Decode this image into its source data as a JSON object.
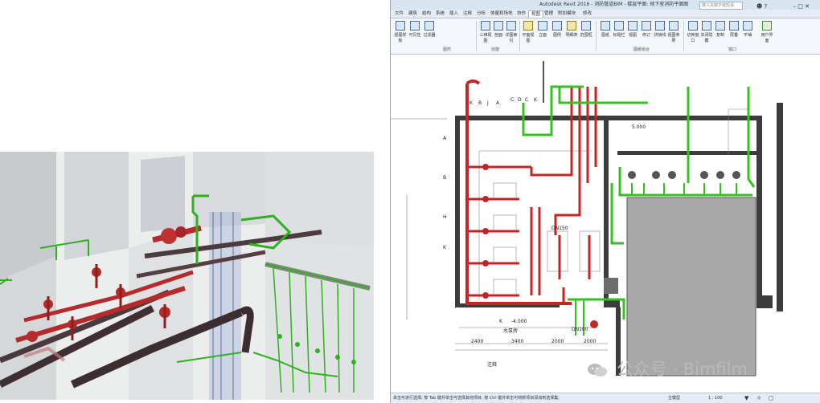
{
  "revit": {
    "title": "Autodesk Revit 2016 -   消防管道BIM - 楼层平面: 地下室消防平面图",
    "search_placeholder": "键入关键字或短语",
    "tabs": [
      "文件",
      "建筑",
      "结构",
      "系统",
      "插入",
      "注释",
      "分析",
      "体量和场地",
      "协作",
      "视图",
      "管理",
      "附加模块",
      "修改"
    ],
    "active_tab_index": 9,
    "panels": [
      {
        "label": "图形",
        "buttons": [
          "视图样板",
          "可见性",
          "过滤器"
        ]
      },
      {
        "label": "创建",
        "buttons": [
          "三维视图",
          "剖面",
          "详图索引",
          "平面视图",
          "立面",
          "图例",
          "明细表",
          "范围框"
        ]
      },
      {
        "label": "图纸组合",
        "buttons": [
          "图纸",
          "标题栏",
          "视图",
          "修订",
          "拼接线",
          "视图参照"
        ]
      },
      {
        "label": "窗口",
        "buttons": [
          "切换窗口",
          "关闭隐藏",
          "复制",
          "层叠",
          "平铺",
          "用户界面"
        ]
      }
    ],
    "plan_labels": {
      "grid_row_1": "A",
      "grid_row_2": "B",
      "grid_row_3": "H",
      "grid_row_4": "K",
      "grid_row_5": "K",
      "top_marks": [
        "K",
        "B",
        "J",
        "A",
        "C",
        "D",
        "C",
        "K"
      ],
      "elev_top": "5.000",
      "elev_bottom": "-4.000",
      "room_name": "水泵房",
      "dims": [
        "2400",
        "3400",
        "2000",
        "2000"
      ],
      "note": "注释",
      "pipe_tag_1": "DN150",
      "pipe_tag_2": "DN100"
    },
    "status_text": "单击可进行选择; 按 Tab 键并单击可选择其他项目; 按 Ctrl 键并单击可将新项目添加到选择集;",
    "status_model": "主模型",
    "status_scale": "1 : 100"
  },
  "watermark": "公众号 · Bimfilm",
  "colors": {
    "fire_pipe": "#c42525",
    "spray_pipe": "#33c21f",
    "wall": "#3c3c3c",
    "tank": "#a8a8a8"
  }
}
